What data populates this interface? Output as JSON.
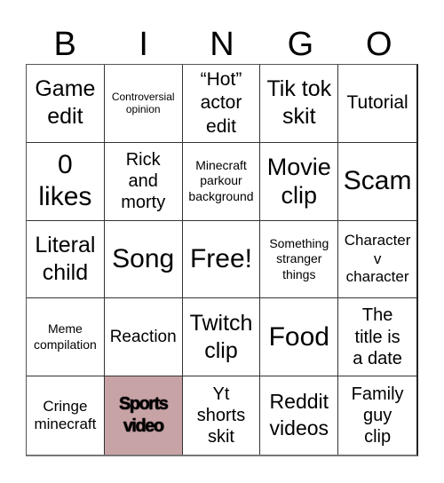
{
  "header": {
    "letters": [
      "B",
      "I",
      "N",
      "G",
      "O"
    ]
  },
  "card": {
    "marked_color": "#c8a3a6",
    "rows": [
      [
        {
          "text": "Game edit",
          "marked": false
        },
        {
          "text": "Controversial opinion",
          "marked": false
        },
        {
          "text": "“Hot” actor edit",
          "marked": false
        },
        {
          "text": "Tik tok skit",
          "marked": false
        },
        {
          "text": "Tutorial",
          "marked": false
        }
      ],
      [
        {
          "text": "0 likes",
          "marked": false
        },
        {
          "text": "Rick and morty",
          "marked": false
        },
        {
          "text": "Minecraft parkour background",
          "marked": false
        },
        {
          "text": "Movie clip",
          "marked": false
        },
        {
          "text": "Scam",
          "marked": false
        }
      ],
      [
        {
          "text": "Literal child",
          "marked": false
        },
        {
          "text": "Song",
          "marked": false
        },
        {
          "text": "Free!",
          "marked": false
        },
        {
          "text": "Something stranger things",
          "marked": false
        },
        {
          "text": "Character v character",
          "marked": false
        }
      ],
      [
        {
          "text": "Meme compilation",
          "marked": false
        },
        {
          "text": "Reaction",
          "marked": false
        },
        {
          "text": "Twitch clip",
          "marked": false
        },
        {
          "text": "Food",
          "marked": false
        },
        {
          "text": "The title is a date",
          "marked": false
        }
      ],
      [
        {
          "text": "Cringe minecraft",
          "marked": false
        },
        {
          "text": "Sports video",
          "marked": true
        },
        {
          "text": "Yt shorts skit",
          "marked": false
        },
        {
          "text": "Reddit videos",
          "marked": false
        },
        {
          "text": "Family guy clip",
          "marked": false
        }
      ]
    ]
  }
}
